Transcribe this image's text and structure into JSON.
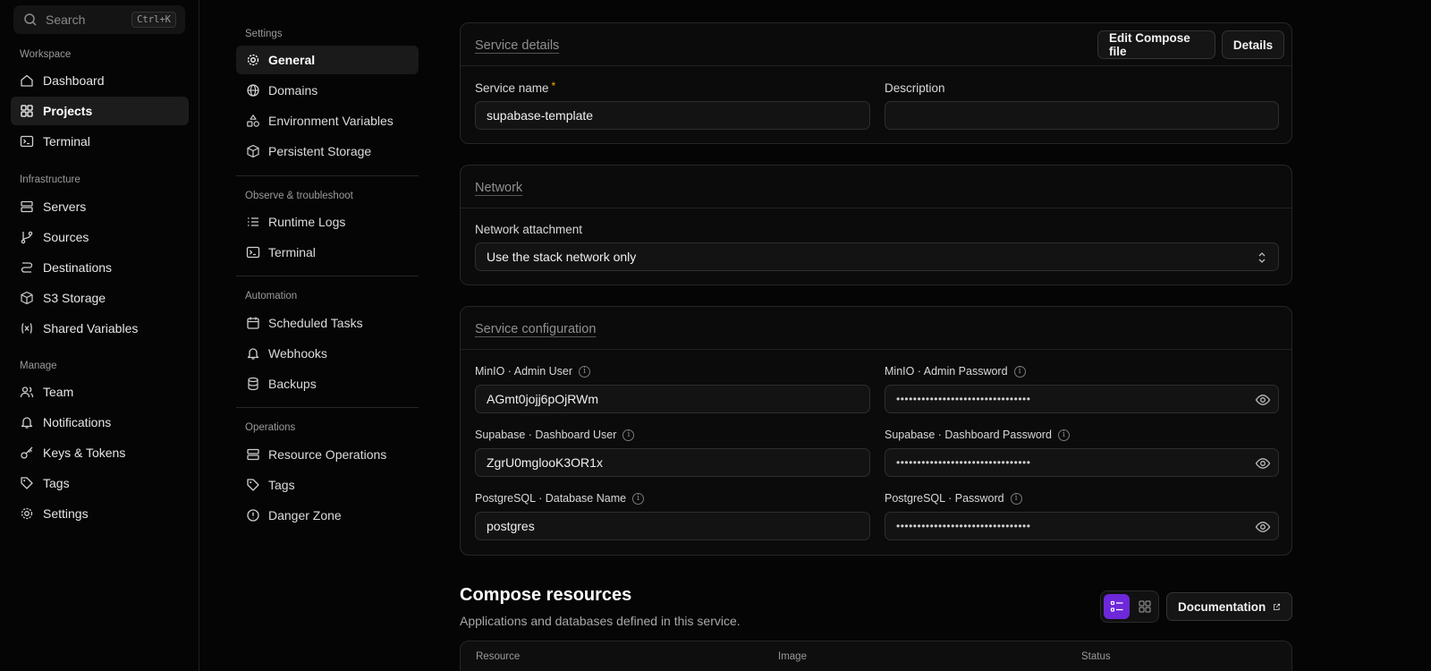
{
  "search": {
    "placeholder": "Search",
    "shortcut": "Ctrl+K"
  },
  "sidebar": {
    "sections": [
      {
        "title": "Workspace",
        "items": [
          {
            "label": "Dashboard",
            "icon": "home-icon"
          },
          {
            "label": "Projects",
            "icon": "grid-icon",
            "active": true
          },
          {
            "label": "Terminal",
            "icon": "terminal-icon"
          }
        ]
      },
      {
        "title": "Infrastructure",
        "items": [
          {
            "label": "Servers",
            "icon": "server-icon"
          },
          {
            "label": "Sources",
            "icon": "git-branch-icon"
          },
          {
            "label": "Destinations",
            "icon": "route-icon"
          },
          {
            "label": "S3 Storage",
            "icon": "box-icon"
          },
          {
            "label": "Shared Variables",
            "icon": "variable-icon"
          }
        ]
      },
      {
        "title": "Manage",
        "items": [
          {
            "label": "Team",
            "icon": "users-icon"
          },
          {
            "label": "Notifications",
            "icon": "bell-icon"
          },
          {
            "label": "Keys & Tokens",
            "icon": "key-icon"
          },
          {
            "label": "Tags",
            "icon": "tag-icon"
          },
          {
            "label": "Settings",
            "icon": "gear-icon"
          }
        ]
      }
    ]
  },
  "settings_nav": {
    "groups": [
      {
        "title": "Settings",
        "items": [
          {
            "label": "General",
            "active": true
          },
          {
            "label": "Domains"
          },
          {
            "label": "Environment Variables"
          },
          {
            "label": "Persistent Storage"
          }
        ]
      },
      {
        "title": "Observe & troubleshoot",
        "items": [
          {
            "label": "Runtime Logs"
          },
          {
            "label": "Terminal"
          }
        ]
      },
      {
        "title": "Automation",
        "items": [
          {
            "label": "Scheduled Tasks"
          },
          {
            "label": "Webhooks"
          },
          {
            "label": "Backups"
          }
        ]
      },
      {
        "title": "Operations",
        "items": [
          {
            "label": "Resource Operations"
          },
          {
            "label": "Tags"
          },
          {
            "label": "Danger Zone"
          }
        ]
      }
    ]
  },
  "service_details": {
    "title": "Service details",
    "edit_compose_label": "Edit Compose file",
    "details_label": "Details",
    "name_label": "Service name",
    "required_mark": "*",
    "name_value": "supabase-template",
    "description_label": "Description",
    "description_value": ""
  },
  "network": {
    "title": "Network",
    "attachment_label": "Network attachment",
    "attachment_value": "Use the stack network only"
  },
  "service_config": {
    "title": "Service configuration",
    "fields": [
      {
        "label": "MinIO · Admin User",
        "value": "AGmt0jojj6pOjRWm",
        "secret": false
      },
      {
        "label": "MinIO · Admin Password",
        "value": "••••••••••••••••••••••••••••••••",
        "secret": true
      },
      {
        "label": "Supabase · Dashboard User",
        "value": "ZgrU0mglooK3OR1x",
        "secret": false
      },
      {
        "label": "Supabase · Dashboard Password",
        "value": "••••••••••••••••••••••••••••••••",
        "secret": true
      },
      {
        "label": "PostgreSQL · Database Name",
        "value": "postgres",
        "secret": false
      },
      {
        "label": "PostgreSQL · Password",
        "value": "••••••••••••••••••••••••••••••••",
        "secret": true
      }
    ]
  },
  "compose_resources": {
    "title": "Compose resources",
    "subtitle": "Applications and databases defined in this service.",
    "documentation_label": "Documentation",
    "columns": [
      "Resource",
      "Image",
      "Status"
    ]
  },
  "colors": {
    "accent": "#6d28d9",
    "required": "#f5b400",
    "background": "#050505"
  }
}
